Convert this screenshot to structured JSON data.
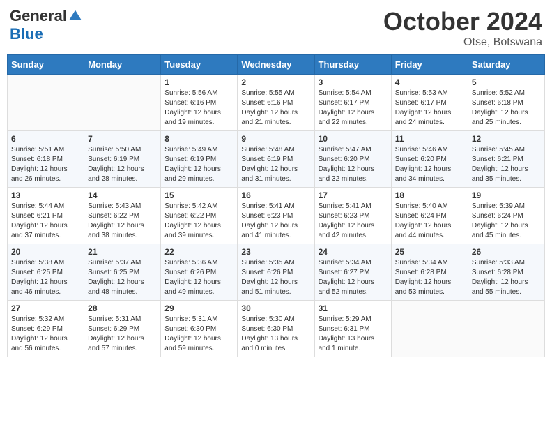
{
  "header": {
    "logo_general": "General",
    "logo_blue": "Blue",
    "month_year": "October 2024",
    "location": "Otse, Botswana"
  },
  "columns": [
    "Sunday",
    "Monday",
    "Tuesday",
    "Wednesday",
    "Thursday",
    "Friday",
    "Saturday"
  ],
  "weeks": [
    [
      {
        "day": "",
        "info": ""
      },
      {
        "day": "",
        "info": ""
      },
      {
        "day": "1",
        "info": "Sunrise: 5:56 AM\nSunset: 6:16 PM\nDaylight: 12 hours\nand 19 minutes."
      },
      {
        "day": "2",
        "info": "Sunrise: 5:55 AM\nSunset: 6:16 PM\nDaylight: 12 hours\nand 21 minutes."
      },
      {
        "day": "3",
        "info": "Sunrise: 5:54 AM\nSunset: 6:17 PM\nDaylight: 12 hours\nand 22 minutes."
      },
      {
        "day": "4",
        "info": "Sunrise: 5:53 AM\nSunset: 6:17 PM\nDaylight: 12 hours\nand 24 minutes."
      },
      {
        "day": "5",
        "info": "Sunrise: 5:52 AM\nSunset: 6:18 PM\nDaylight: 12 hours\nand 25 minutes."
      }
    ],
    [
      {
        "day": "6",
        "info": "Sunrise: 5:51 AM\nSunset: 6:18 PM\nDaylight: 12 hours\nand 26 minutes."
      },
      {
        "day": "7",
        "info": "Sunrise: 5:50 AM\nSunset: 6:19 PM\nDaylight: 12 hours\nand 28 minutes."
      },
      {
        "day": "8",
        "info": "Sunrise: 5:49 AM\nSunset: 6:19 PM\nDaylight: 12 hours\nand 29 minutes."
      },
      {
        "day": "9",
        "info": "Sunrise: 5:48 AM\nSunset: 6:19 PM\nDaylight: 12 hours\nand 31 minutes."
      },
      {
        "day": "10",
        "info": "Sunrise: 5:47 AM\nSunset: 6:20 PM\nDaylight: 12 hours\nand 32 minutes."
      },
      {
        "day": "11",
        "info": "Sunrise: 5:46 AM\nSunset: 6:20 PM\nDaylight: 12 hours\nand 34 minutes."
      },
      {
        "day": "12",
        "info": "Sunrise: 5:45 AM\nSunset: 6:21 PM\nDaylight: 12 hours\nand 35 minutes."
      }
    ],
    [
      {
        "day": "13",
        "info": "Sunrise: 5:44 AM\nSunset: 6:21 PM\nDaylight: 12 hours\nand 37 minutes."
      },
      {
        "day": "14",
        "info": "Sunrise: 5:43 AM\nSunset: 6:22 PM\nDaylight: 12 hours\nand 38 minutes."
      },
      {
        "day": "15",
        "info": "Sunrise: 5:42 AM\nSunset: 6:22 PM\nDaylight: 12 hours\nand 39 minutes."
      },
      {
        "day": "16",
        "info": "Sunrise: 5:41 AM\nSunset: 6:23 PM\nDaylight: 12 hours\nand 41 minutes."
      },
      {
        "day": "17",
        "info": "Sunrise: 5:41 AM\nSunset: 6:23 PM\nDaylight: 12 hours\nand 42 minutes."
      },
      {
        "day": "18",
        "info": "Sunrise: 5:40 AM\nSunset: 6:24 PM\nDaylight: 12 hours\nand 44 minutes."
      },
      {
        "day": "19",
        "info": "Sunrise: 5:39 AM\nSunset: 6:24 PM\nDaylight: 12 hours\nand 45 minutes."
      }
    ],
    [
      {
        "day": "20",
        "info": "Sunrise: 5:38 AM\nSunset: 6:25 PM\nDaylight: 12 hours\nand 46 minutes."
      },
      {
        "day": "21",
        "info": "Sunrise: 5:37 AM\nSunset: 6:25 PM\nDaylight: 12 hours\nand 48 minutes."
      },
      {
        "day": "22",
        "info": "Sunrise: 5:36 AM\nSunset: 6:26 PM\nDaylight: 12 hours\nand 49 minutes."
      },
      {
        "day": "23",
        "info": "Sunrise: 5:35 AM\nSunset: 6:26 PM\nDaylight: 12 hours\nand 51 minutes."
      },
      {
        "day": "24",
        "info": "Sunrise: 5:34 AM\nSunset: 6:27 PM\nDaylight: 12 hours\nand 52 minutes."
      },
      {
        "day": "25",
        "info": "Sunrise: 5:34 AM\nSunset: 6:28 PM\nDaylight: 12 hours\nand 53 minutes."
      },
      {
        "day": "26",
        "info": "Sunrise: 5:33 AM\nSunset: 6:28 PM\nDaylight: 12 hours\nand 55 minutes."
      }
    ],
    [
      {
        "day": "27",
        "info": "Sunrise: 5:32 AM\nSunset: 6:29 PM\nDaylight: 12 hours\nand 56 minutes."
      },
      {
        "day": "28",
        "info": "Sunrise: 5:31 AM\nSunset: 6:29 PM\nDaylight: 12 hours\nand 57 minutes."
      },
      {
        "day": "29",
        "info": "Sunrise: 5:31 AM\nSunset: 6:30 PM\nDaylight: 12 hours\nand 59 minutes."
      },
      {
        "day": "30",
        "info": "Sunrise: 5:30 AM\nSunset: 6:30 PM\nDaylight: 13 hours\nand 0 minutes."
      },
      {
        "day": "31",
        "info": "Sunrise: 5:29 AM\nSunset: 6:31 PM\nDaylight: 13 hours\nand 1 minute."
      },
      {
        "day": "",
        "info": ""
      },
      {
        "day": "",
        "info": ""
      }
    ]
  ]
}
